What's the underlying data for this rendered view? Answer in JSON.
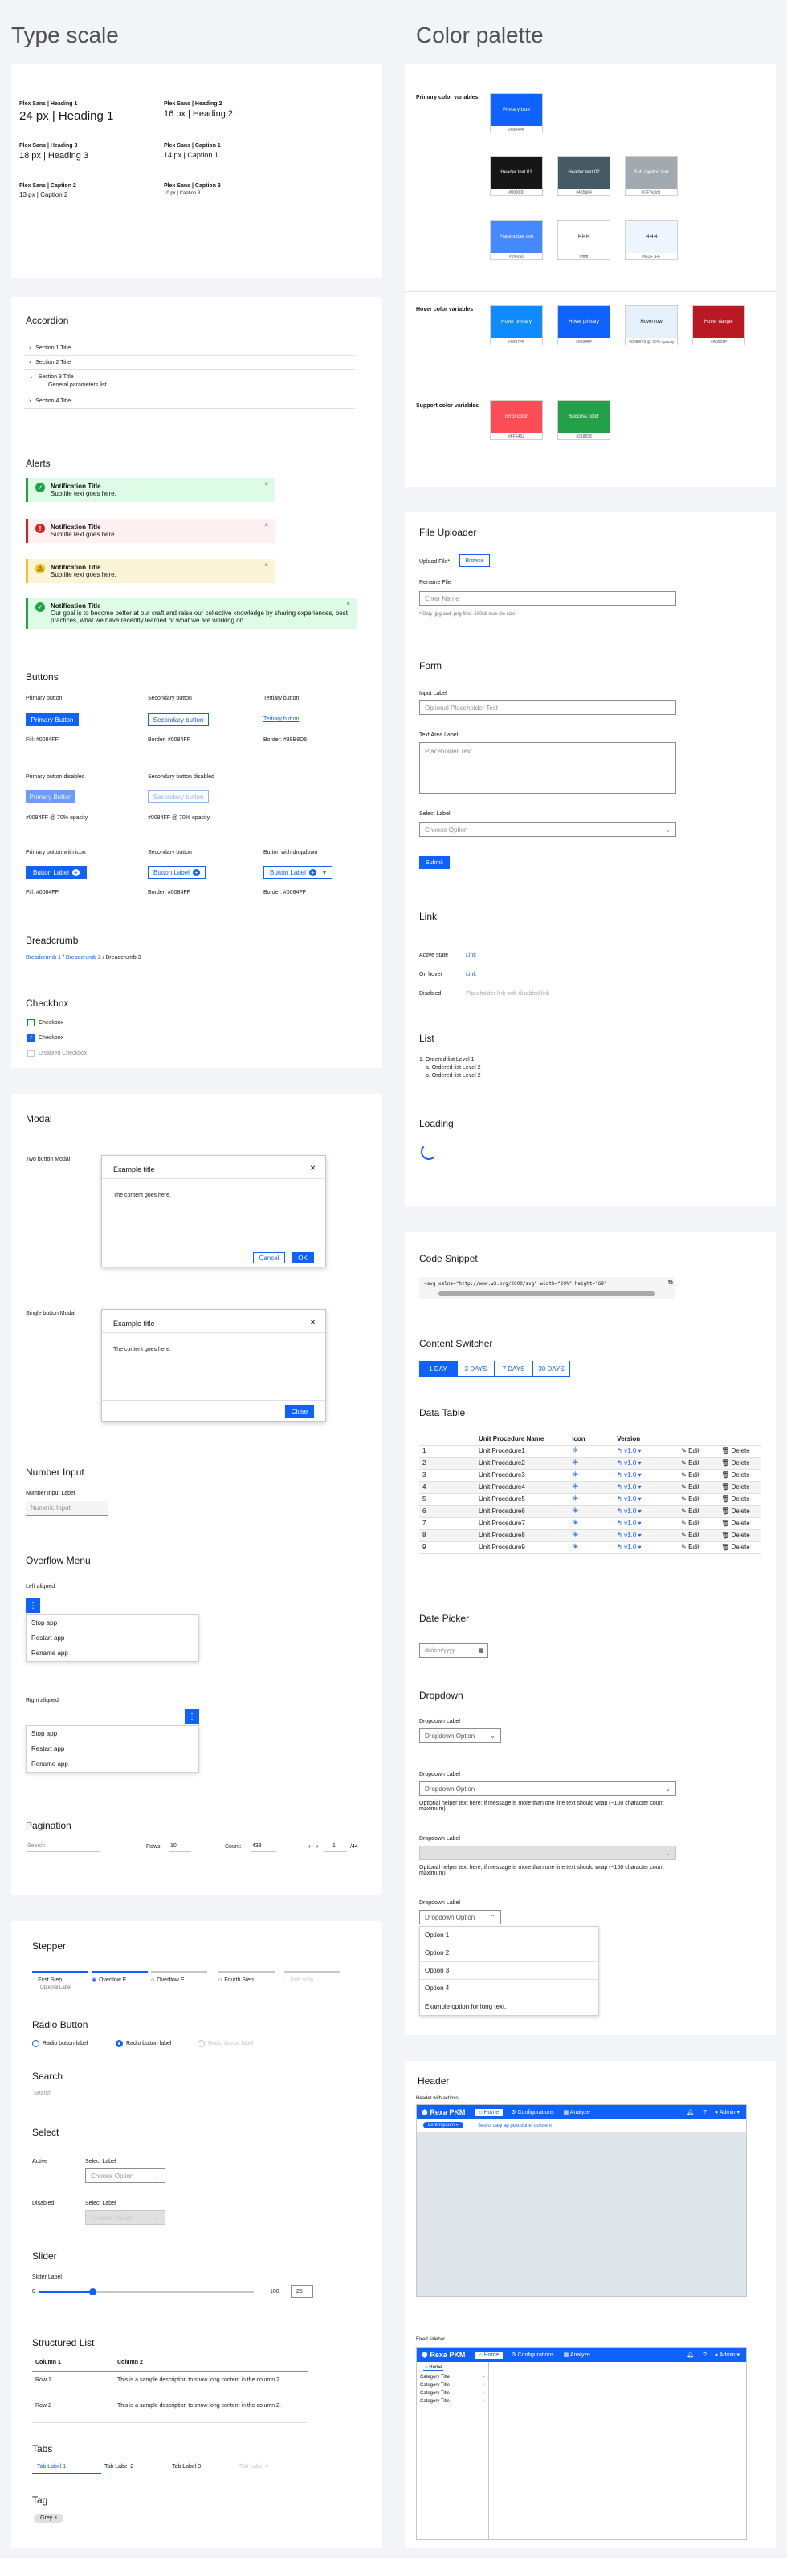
{
  "titles": {
    "type_scale": "Type scale",
    "color_palette": "Color palette"
  },
  "type_scale": [
    {
      "label": "Plex Sans | Heading 1",
      "sample": "24 px | Heading 1"
    },
    {
      "label": "Plex Sans | Heading 2",
      "sample": "16 px | Heading 2"
    },
    {
      "label": "Plex Sans | Heading 3",
      "sample": "18 px | Heading 3"
    },
    {
      "label": "Plex Sans | Caption 1",
      "sample": "14 px | Caption 1"
    },
    {
      "label": "Plex Sans | Caption 2",
      "sample": "13 px | Caption 2"
    },
    {
      "label": "Plex Sans | Caption 3",
      "sample": "10 px | Caption 3"
    }
  ],
  "palette": {
    "primary_title": "Primary color variables",
    "hover_title": "Hover color variables",
    "support_title": "Support color variables",
    "primary": [
      {
        "name": "Primary blue",
        "code": "#0084FF",
        "bg": "#0f62fe",
        "fg": "#ffffff"
      },
      {
        "name": "Header text 01",
        "code": "#000000",
        "bg": "#161616",
        "fg": "#ffffff"
      },
      {
        "name": "Header text 02",
        "code": "#455a64",
        "bg": "#455a64",
        "fg": "#ffffff"
      },
      {
        "name": "Sub caption text",
        "code": "#7F7e0c0",
        "bg": "#a2a9b0",
        "fg": "#ffffff"
      },
      {
        "name": "Placeholder text",
        "code": "#2f4050",
        "bg": "#4589ff",
        "fg": "#ffffff"
      },
      {
        "name": "f4f4f4",
        "code": "#ffffff",
        "bg": "#ffffff",
        "fg": "#161616"
      },
      {
        "name": "f4f4f4",
        "code": "#EDF1F6",
        "bg": "#edf5ff",
        "fg": "#161616"
      }
    ],
    "hover": [
      {
        "name": "Hover primary",
        "code": "#0087FF",
        "bg": "#0f8aff",
        "fg": "#ffffff"
      },
      {
        "name": "Hover primary",
        "code": "#0084FF",
        "bg": "#0f62fe",
        "fg": "#ffffff"
      },
      {
        "name": "Hover row",
        "code": "#D0EEF3 @ 50% opacity",
        "bg": "#e5f0fb",
        "fg": "#161616"
      },
      {
        "name": "Hover danger",
        "code": "#A0201F",
        "bg": "#b81922",
        "fg": "#ffffff"
      }
    ],
    "support": [
      {
        "name": "Error color",
        "code": "#FF5462",
        "bg": "#fa4d56",
        "fg": "#ffffff"
      },
      {
        "name": "Success color",
        "code": "#218838",
        "bg": "#24a148",
        "fg": "#ffffff"
      }
    ]
  },
  "accordion": {
    "title": "Accordion",
    "items": [
      "Section 1 Title",
      "Section 2 Title",
      "Section 3 Title",
      "Section 4 Title"
    ],
    "open_text": "General parameters list."
  },
  "alerts": {
    "title": "Alerts",
    "items": [
      {
        "title": "Notification Title",
        "sub": "Subtitle text goes here.",
        "bg": "#defbe6",
        "border": "#24a148",
        "icon": "#24a148"
      },
      {
        "title": "Notification Title",
        "sub": "Subtitle text goes here.",
        "bg": "#fff1f1",
        "border": "#da1e28",
        "icon": "#da1e28"
      },
      {
        "title": "Notification Title",
        "sub": "Subtitle text goes here.",
        "bg": "#fcf4d6",
        "border": "#f1c21b",
        "icon": "#f1c21b"
      },
      {
        "title": "Notification Title",
        "sub": "Our goal is to become better at our craft and raise our collective knowledge by sharing experiences, best practices, what we have recently learned or what we are working on.",
        "bg": "#defbe6",
        "border": "#24a148",
        "icon": "#24a148"
      }
    ]
  },
  "buttons": {
    "title": "Buttons",
    "primary_h": "Primary button",
    "secondary_h": "Secondary button",
    "tertiary_h": "Tertiary button",
    "primary_label": "Primary Button",
    "secondary_label": "Secondary button",
    "tertiary_label": "Tertiary button",
    "fill": "Fill: #0084FF",
    "border": "Border: #0084FF",
    "border_t": "Border: #39B8D6",
    "pd_h": "Primary button disabled",
    "sd_h": "Secondary button disabled",
    "pd_note": "#0084FF @ 70% opacity",
    "sd_note": "#0084FF @ 70% opacity",
    "icon_h": "Primary button with icon",
    "sec2_h": "Secondary button",
    "dd_h": "Button with dropdown",
    "label": "Button Label",
    "fill2": "Fill: #0084FF",
    "border2": "Border: #0084FF",
    "border3": "Border: #0084FF"
  },
  "breadcrumb": {
    "title": "Breadcrumb",
    "b1": "Breadcrumb 1",
    "b2": "Breadcrumb 2",
    "b3": "Breadcrumb 3"
  },
  "checkbox": {
    "title": "Checkbox",
    "c1": "Checkbox",
    "c2": "Checkbox",
    "c3": "Disabled Checkbox"
  },
  "modal": {
    "title": "Modal",
    "two": "Two button Modal",
    "single": "Single button Modal",
    "mtitle": "Example title",
    "content": "The content goes here.",
    "cancel": "Cancel",
    "ok": "OK",
    "close": "Close"
  },
  "number_input": {
    "title": "Number Input",
    "label": "Number Input Label",
    "placeholder": "Numeric Input"
  },
  "overflow": {
    "title": "Overflow Menu",
    "left": "Left aligned",
    "right": "Right aligned",
    "items": [
      "Stop app",
      "Restart app",
      "Rename app"
    ]
  },
  "pagination": {
    "title": "Pagination",
    "search": "Search",
    "rows_l": "Rows:",
    "rows_v": "10",
    "count_l": "Count:",
    "count_v": "433",
    "page": "1",
    "of": "/44"
  },
  "file_uploader": {
    "title": "File Uploader",
    "upload_l": "Upload File*",
    "browse": "Browse",
    "rename_l": "Rename File",
    "rename_ph": "Enter Name",
    "note": "* Only .jpg and .png files. 500kb max file size."
  },
  "form": {
    "title": "Form",
    "input_l": "Input Label",
    "input_ph": "Optional Placeholder Text",
    "ta_l": "Text Area Label",
    "ta_ph": "Placeholder Text",
    "sel_l": "Select Label",
    "sel_v": "Choose Option",
    "submit": "Submit"
  },
  "link": {
    "title": "Link",
    "active_l": "Active state",
    "active_v": "Link",
    "hover_l": "On hover",
    "hover_v": "Link",
    "dis_l": "Disabled",
    "dis_v": "Placeholder link with disabled link"
  },
  "list": {
    "title": "List",
    "items": [
      "1. Ordered list Level 1",
      "a. Ordered list Level 2",
      "b. Ordered list Level 2"
    ]
  },
  "loading": {
    "title": "Loading"
  },
  "code": {
    "title": "Code Snippet",
    "text": "<svg xmlns=\"http://www.w3.org/2000/svg\" width=\"20%\" height=\"69\""
  },
  "switcher": {
    "title": "Content Switcher",
    "opts": [
      "1 DAY",
      "3 DAYS",
      "7 DAYS",
      "30 DAYS"
    ]
  },
  "table": {
    "title": "Data Table",
    "h_name": "Unit Procedure Name",
    "h_icon": "Icon",
    "h_ver": "Version",
    "edit": "Edit",
    "del": "Delete",
    "ver": "v1.0",
    "rows": [
      [
        "1",
        "Unit Procedure1"
      ],
      [
        "2",
        "Unit Procedure2"
      ],
      [
        "3",
        "Unit Procedure3"
      ],
      [
        "4",
        "Unit Procedure4"
      ],
      [
        "5",
        "Unit Procedure5"
      ],
      [
        "6",
        "Unit Procedure6"
      ],
      [
        "7",
        "Unit Procedure7"
      ],
      [
        "8",
        "Unit Procedure8"
      ],
      [
        "9",
        "Unit Procedure9"
      ]
    ]
  },
  "datepicker": {
    "title": "Date Picker",
    "ph": "dd/mm/yyyy"
  },
  "dropdown": {
    "title": "Dropdown",
    "label": "Dropdown Label",
    "val": "Dropdown Option",
    "helper": "Optional helper text here; if message is more than one line text should wrap (~100 character count maximum)",
    "opts": [
      "Option 1",
      "Option 2",
      "Option 3",
      "Option 4",
      "Example option for long text."
    ]
  },
  "stepper": {
    "title": "Stepper",
    "steps": [
      "First Step",
      "Overflow E...",
      "Overflow E...",
      "Fourth Step",
      "Fifth step"
    ],
    "optional": "Optional Label"
  },
  "radio": {
    "title": "Radio Button",
    "r1": "Radio button label",
    "r2": "Radio button label",
    "r3": "Radio button label"
  },
  "search": {
    "title": "Search",
    "ph": "Search"
  },
  "select": {
    "title": "Select",
    "active": "Active",
    "disabled": "Disabled",
    "label": "Select Label",
    "val": "Choose Option"
  },
  "slider": {
    "title": "Slider",
    "label": "Slider Label",
    "min": "0",
    "max": "100",
    "value": "25",
    "fraction": 0.25
  },
  "slist": {
    "title": "Structured List",
    "c1": "Column 1",
    "c2": "Column 2",
    "rows": [
      [
        "Row 1",
        "This is a sample description to show long content in the column 2."
      ],
      [
        "Row 2",
        "This is a sample description to show long content in the column 2."
      ]
    ]
  },
  "tabs": {
    "title": "Tabs",
    "items": [
      "Tab Label 1",
      "Tab Label 2",
      "Tab Label 3",
      "Tab Label 4"
    ]
  },
  "tag": {
    "title": "Tag",
    "label": "Grey"
  },
  "header": {
    "title": "Header",
    "with_actions": "Header with actions",
    "fixed": "Fixed sidebar",
    "brand": "Rexa PKM",
    "tabs": [
      "Home",
      "Configurations",
      "Analyze"
    ],
    "admin": "Admin",
    "chip": "Loremipsum",
    "link": "Sed ut cary ap post done, dolorem",
    "menu": [
      "Category Title",
      "Category Title",
      "Category Title",
      "Category Title"
    ],
    "home": "Home"
  }
}
